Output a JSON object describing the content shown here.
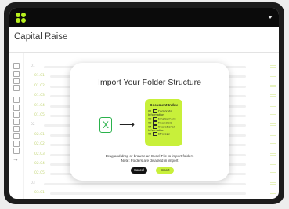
{
  "app": {
    "title": "Capital Raise"
  },
  "sidebar": {
    "icons": [
      "list-icon",
      "bank-icon",
      "document-icon",
      "image-icon",
      "list-icon",
      "bank-icon",
      "document-icon",
      "document-icon",
      "image-icon",
      "lock-icon",
      "calendar-icon",
      "info-icon",
      "arrow-right-icon"
    ]
  },
  "rows": [
    {
      "num": "01",
      "sub": false
    },
    {
      "num": "01.01",
      "sub": true
    },
    {
      "num": "01.02",
      "sub": true
    },
    {
      "num": "01.03",
      "sub": true
    },
    {
      "num": "01.04",
      "sub": true
    },
    {
      "num": "01.05",
      "sub": true
    },
    {
      "num": "02",
      "sub": false
    },
    {
      "num": "02.01",
      "sub": true
    },
    {
      "num": "02.02",
      "sub": true
    },
    {
      "num": "02.03",
      "sub": true
    },
    {
      "num": "02.04",
      "sub": true
    },
    {
      "num": "02.05",
      "sub": true
    },
    {
      "num": "03",
      "sub": false
    },
    {
      "num": "03.01",
      "sub": true
    }
  ],
  "modal": {
    "title": "Import Your Folder Structure",
    "doc_index_title": "Document Index",
    "doc_items": [
      {
        "num": "01",
        "label": "Corporate Information"
      },
      {
        "num": "02",
        "label": "Employment"
      },
      {
        "num": "03",
        "label": "Financials"
      },
      {
        "num": "04",
        "label": "Operational Information"
      },
      {
        "num": "05",
        "label": "Strategy"
      }
    ],
    "message_line1": "Drag and drop or browse an Excel File to import folders",
    "message_line2": "Note: Folders are disabled in import",
    "cancel_label": "Cancel",
    "import_label": "Import"
  },
  "colors": {
    "accent": "#c8f03a",
    "excel": "#2bb24c"
  }
}
